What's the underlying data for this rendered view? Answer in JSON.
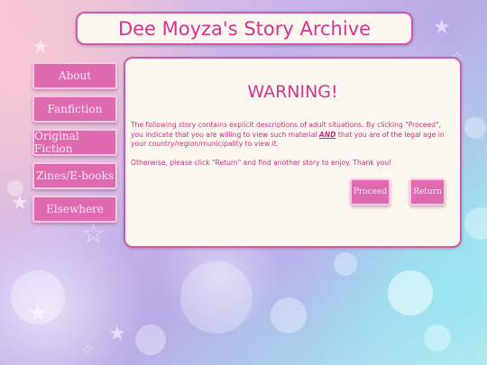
{
  "site_title": "Dee Moyza's Story Archive",
  "nav": [
    {
      "label": "About"
    },
    {
      "label": "Fanfiction"
    },
    {
      "label": "Original Fiction"
    },
    {
      "label": "Zines/E-books"
    },
    {
      "label": "Elsewhere"
    }
  ],
  "warning": {
    "title": "WARNING!",
    "para1_before": "The following story contains explicit descriptions of adult situations. By clicking \"Proceed\", you indicate that you are willing to view such material ",
    "para1_emph": "AND",
    "para1_after": " that you are of the legal age in your country/region/municipality to view it.",
    "para2": "Otherwise, please click \"Return\" and find another story to enjoy. Thank you!"
  },
  "buttons": {
    "proceed": "Proceed",
    "return": "Return"
  },
  "colors": {
    "accent": "#d4358f",
    "button": "#e06ab0",
    "panel": "#fcf8f0"
  }
}
